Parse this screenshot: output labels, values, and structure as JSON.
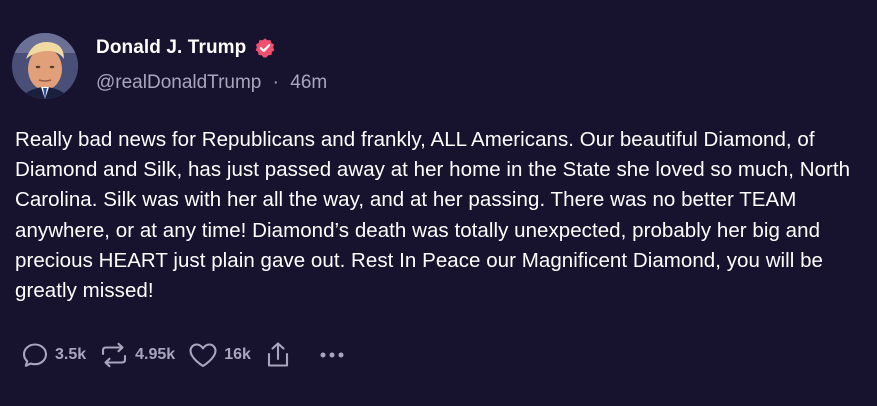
{
  "author": {
    "display_name": "Donald J. Trump",
    "handle": "@realDonaldTrump",
    "separator": "·",
    "time": "46m",
    "verified": true
  },
  "post": {
    "text": "Really bad news for Republicans and frankly, ALL Americans. Our beautiful Diamond, of Diamond and Silk, has just passed away at her home in the State she loved so much, North Carolina. Silk was with her all the way, and at her passing. There was no better TEAM anywhere, or at any time! Diamond’s death was totally unexpected, probably her big and precious HEART just plain gave out. Rest In Peace our Magnificent Diamond, you will be greatly missed!"
  },
  "actions": {
    "replies": "3.5k",
    "reposts": "4.95k",
    "likes": "16k",
    "share_icon": "share-icon",
    "more_icon": "more-icon"
  },
  "colors": {
    "background": "#17122e",
    "text": "#ffffff",
    "muted": "#a9a5bd",
    "verified_badge": "#f0506e"
  }
}
